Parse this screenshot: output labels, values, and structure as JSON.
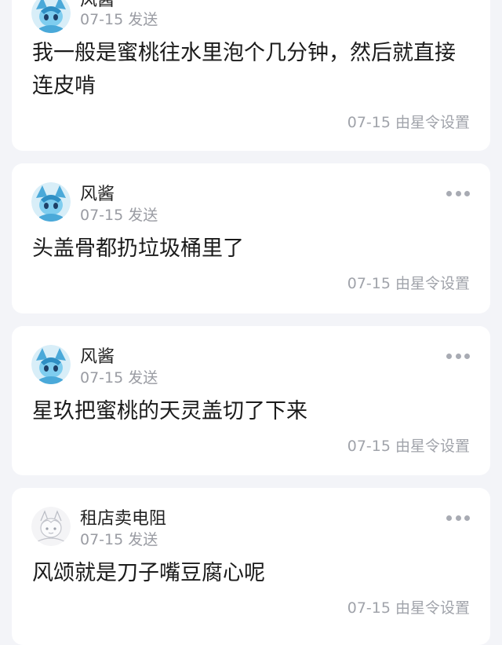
{
  "posts": [
    {
      "author": "风酱",
      "meta": "07-15 发送",
      "content": "我一般是蜜桃往水里泡个几分钟，然后就直接连皮啃",
      "footer": "07-15 由星令设置",
      "avatar": "blue-eevee-avatar"
    },
    {
      "author": "风酱",
      "meta": "07-15 发送",
      "content": "头盖骨都扔垃圾桶里了",
      "footer": "07-15 由星令设置",
      "avatar": "blue-eevee-avatar"
    },
    {
      "author": "风酱",
      "meta": "07-15 发送",
      "content": "星玖把蜜桃的天灵盖切了下来",
      "footer": "07-15 由星令设置",
      "avatar": "blue-eevee-avatar"
    },
    {
      "author": "租店卖电阻",
      "meta": "07-15 发送",
      "content": "风颂就是刀子嘴豆腐心呢",
      "footer": "07-15 由星令设置",
      "avatar": "sketch-character-avatar"
    }
  ],
  "colors": {
    "background": "#f3f4f8",
    "card": "#ffffff",
    "secondary_text": "#9a9ca3",
    "avatar_blue": "#6ec3e8"
  }
}
